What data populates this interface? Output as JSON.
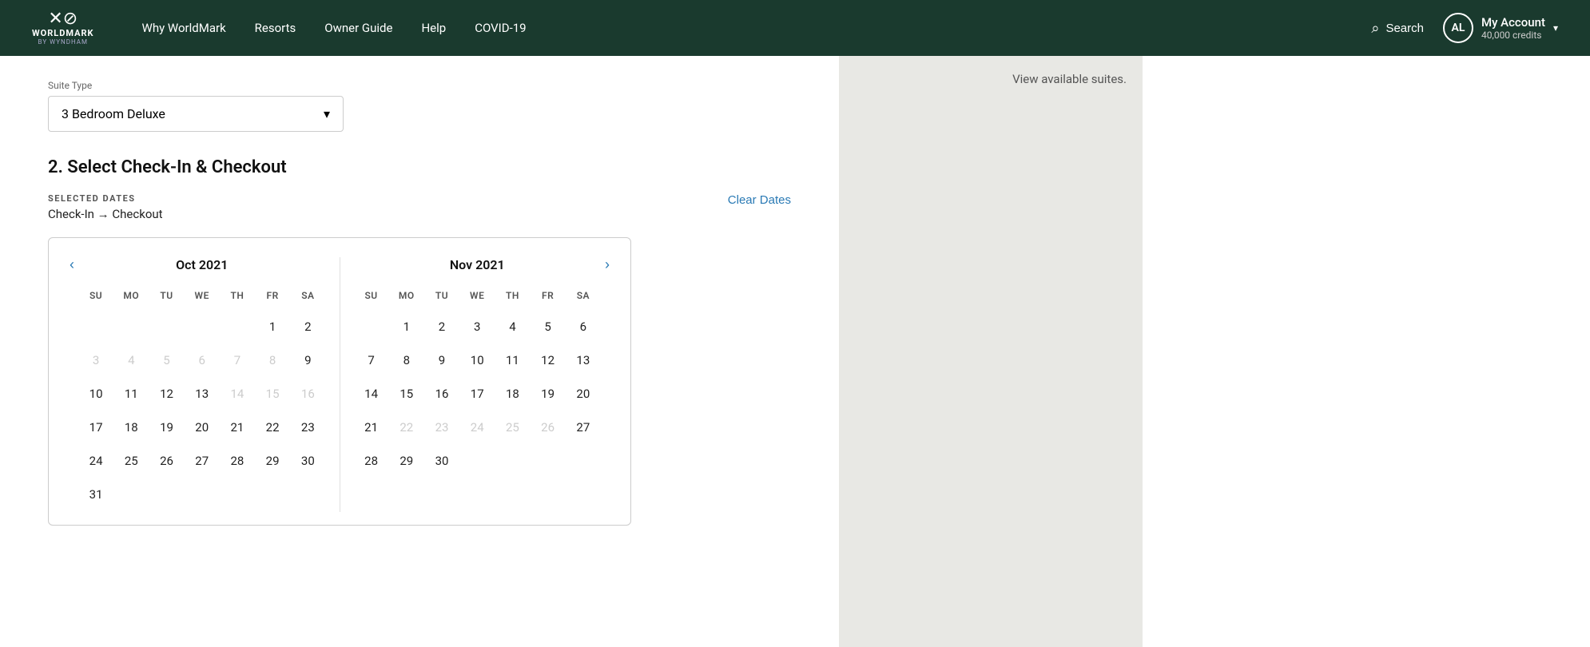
{
  "nav": {
    "logo_text": "WORLDMARK",
    "logo_sub": "BY WYNDHAM",
    "links": [
      "Why WorldMark",
      "Resorts",
      "Owner Guide",
      "Help",
      "COVID-19"
    ],
    "search_label": "Search",
    "account_name": "My Account",
    "account_credits": "40,000 credits",
    "avatar_initials": "AL"
  },
  "suite": {
    "label": "Suite Type",
    "value": "3 Bedroom Deluxe"
  },
  "section": {
    "heading": "2. Select Check-In & Checkout"
  },
  "dates": {
    "label": "SELECTED DATES",
    "value": "Check-In → Checkout",
    "clear_label": "Clear Dates"
  },
  "sidebar": {
    "text": "View available suites."
  },
  "calendar": {
    "left": {
      "title": "Oct 2021",
      "days_header": [
        "SU",
        "MO",
        "TU",
        "WE",
        "TH",
        "FR",
        "SA"
      ],
      "weeks": [
        [
          "",
          "",
          "",
          "",
          "",
          "1",
          "2"
        ],
        [
          "3",
          "4",
          "5",
          "6",
          "7",
          "8",
          "9"
        ],
        [
          "10",
          "11",
          "12",
          "13",
          "14",
          "15",
          "16"
        ],
        [
          "17",
          "18",
          "19",
          "20",
          "21",
          "22",
          "23"
        ],
        [
          "24",
          "25",
          "26",
          "27",
          "28",
          "29",
          "30"
        ],
        [
          "31",
          "",
          "",
          "",
          "",
          "",
          ""
        ]
      ],
      "disabled": [
        "3",
        "4",
        "5",
        "6",
        "7",
        "8",
        "14",
        "15",
        "16"
      ]
    },
    "right": {
      "title": "Nov 2021",
      "days_header": [
        "SU",
        "MO",
        "TU",
        "WE",
        "TH",
        "FR",
        "SA"
      ],
      "weeks": [
        [
          "",
          "1",
          "2",
          "3",
          "4",
          "5",
          "6"
        ],
        [
          "7",
          "8",
          "9",
          "10",
          "11",
          "12",
          "13"
        ],
        [
          "14",
          "15",
          "16",
          "17",
          "18",
          "19",
          "20"
        ],
        [
          "21",
          "22",
          "23",
          "24",
          "25",
          "26",
          "27"
        ],
        [
          "28",
          "29",
          "30",
          "",
          "",
          "",
          ""
        ]
      ],
      "disabled": [
        "22",
        "23",
        "24",
        "25",
        "26"
      ]
    }
  }
}
